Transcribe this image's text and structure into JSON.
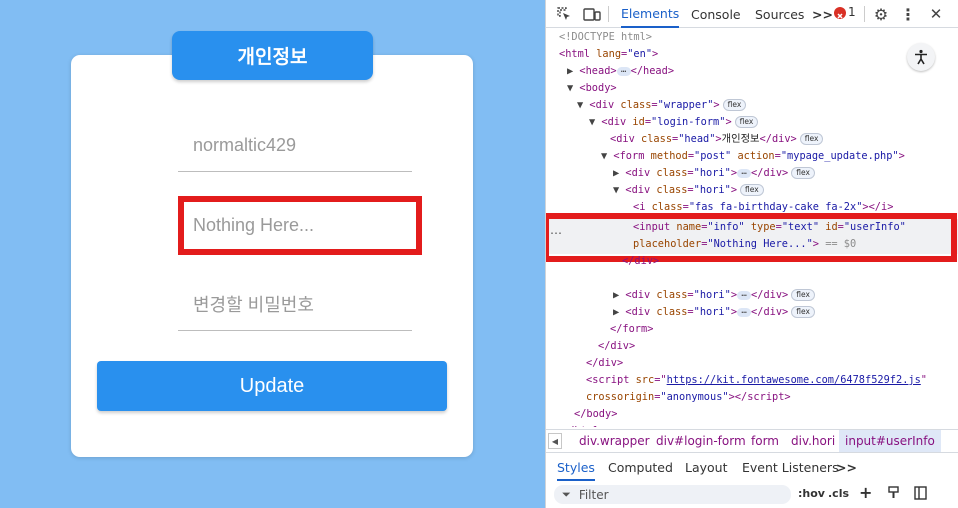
{
  "page": {
    "head_title": "개인정보",
    "fields": [
      {
        "value": "normaltic429"
      },
      {
        "placeholder": "Nothing Here..."
      },
      {
        "placeholder": "변경할 비밀번호"
      }
    ],
    "update_label": "Update"
  },
  "devtools": {
    "tabs": [
      "Elements",
      "Console",
      "Sources"
    ],
    "more_tabs": ">>",
    "error_count": "1",
    "dom": {
      "doctype": "<!DOCTYPE html>",
      "html_tag": "html",
      "lang_attr": "lang",
      "lang_val": "\"en\"",
      "head_tag": "head",
      "body_tag": "body",
      "div": "div",
      "class_attr": "class",
      "id_attr": "id",
      "wrapper_val": "\"wrapper\"",
      "login_val": "\"login-form\"",
      "head_val": "\"head\"",
      "head_text": "개인정보",
      "form_tag": "form",
      "method_attr": "method",
      "method_val": "\"post\"",
      "action_attr": "action",
      "action_val": "\"mypage_update.php\"",
      "hori_val": "\"hori\"",
      "i_tag": "i",
      "i_class_val": "\"fas fa-birthday-cake fa-2x\"",
      "input_tag": "input",
      "name_attr": "name",
      "name_val": "\"info\"",
      "type_attr": "type",
      "type_val": "\"text\"",
      "userinfo_val": "\"userInfo\"",
      "placeholder_attr": "placeholder",
      "placeholder_val": "\"Nothing Here...\"",
      "eq_ref": "== $0",
      "script_tag": "script",
      "src_attr": "src",
      "src_val": "https://kit.fontawesome.com/6478f529f2.js",
      "crossorigin_attr": "crossorigin",
      "crossorigin_val": "\"anonymous\"",
      "flex_badge": "flex",
      "ellipsis": "…"
    },
    "breadcrumbs": [
      "div.wrapper",
      "div#login-form",
      "form",
      "div.hori",
      "input#userInfo"
    ],
    "styles_tabs": [
      "Styles",
      "Computed",
      "Layout",
      "Event Listeners",
      ">>"
    ],
    "filter_placeholder": "Filter",
    "filter_tools": [
      ":hov",
      ".cls",
      "+"
    ],
    "colors": {
      "accent": "#1a60c9",
      "highlight": "#e31c1c",
      "page_bg": "#81bdf3",
      "button": "#2990ee"
    }
  }
}
